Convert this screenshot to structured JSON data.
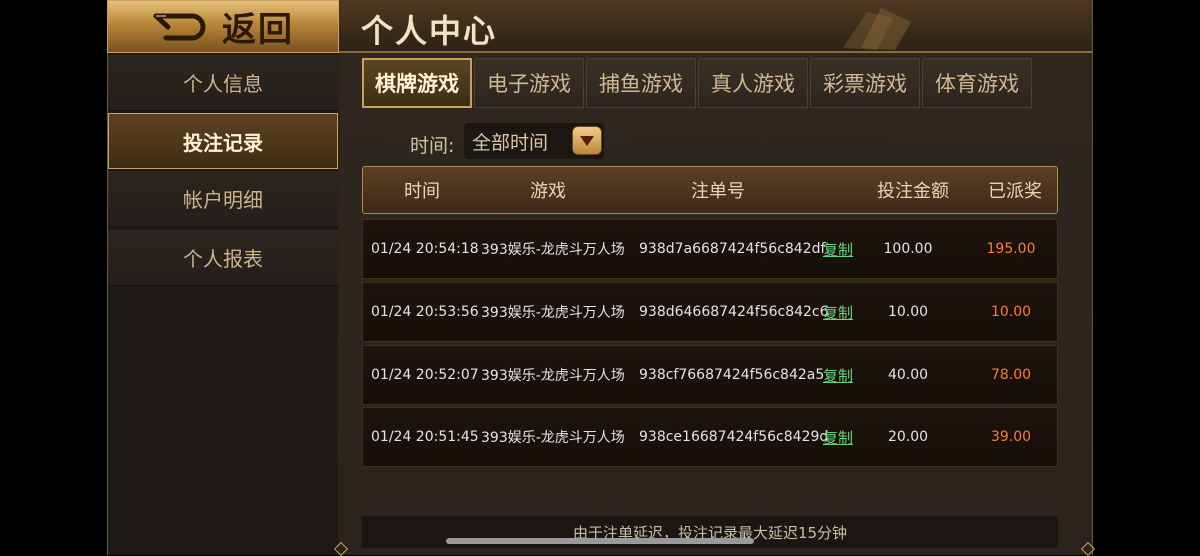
{
  "back": {
    "label": "返回"
  },
  "header": {
    "title": "个人中心"
  },
  "sidebar": {
    "items": [
      {
        "label": "个人信息",
        "active": false
      },
      {
        "label": "投注记录",
        "active": true
      },
      {
        "label": "帐户明细",
        "active": false
      },
      {
        "label": "个人报表",
        "active": false
      }
    ]
  },
  "tabs": [
    {
      "label": "棋牌游戏",
      "active": true
    },
    {
      "label": "电子游戏",
      "active": false
    },
    {
      "label": "捕鱼游戏",
      "active": false
    },
    {
      "label": "真人游戏",
      "active": false
    },
    {
      "label": "彩票游戏",
      "active": false
    },
    {
      "label": "体育游戏",
      "active": false
    }
  ],
  "filter": {
    "label": "时间:",
    "value": "全部时间"
  },
  "table": {
    "columns": [
      "时间",
      "游戏",
      "注单号",
      "投注金额",
      "已派奖"
    ],
    "rows": [
      {
        "time": "01/24 20:54:18",
        "game": "393娱乐-龙虎斗万人场",
        "order": "938d7a6687424f56c842df",
        "copy": "复制",
        "amount": "100.00",
        "payout": "195.00"
      },
      {
        "time": "01/24 20:53:56",
        "game": "393娱乐-龙虎斗万人场",
        "order": "938d646687424f56c842c6",
        "copy": "复制",
        "amount": "10.00",
        "payout": "10.00"
      },
      {
        "time": "01/24 20:52:07",
        "game": "393娱乐-龙虎斗万人场",
        "order": "938cf76687424f56c842a5",
        "copy": "复制",
        "amount": "40.00",
        "payout": "78.00"
      },
      {
        "time": "01/24 20:51:45",
        "game": "393娱乐-龙虎斗万人场",
        "order": "938ce16687424f56c8429d",
        "copy": "复制",
        "amount": "20.00",
        "payout": "39.00"
      }
    ]
  },
  "notice": "由于注单延迟，投注记录最大延迟15分钟",
  "colors": {
    "accent_gold": "#c9a05c",
    "payout_orange": "#ff7a3a",
    "copy_green": "#6cd47f"
  }
}
